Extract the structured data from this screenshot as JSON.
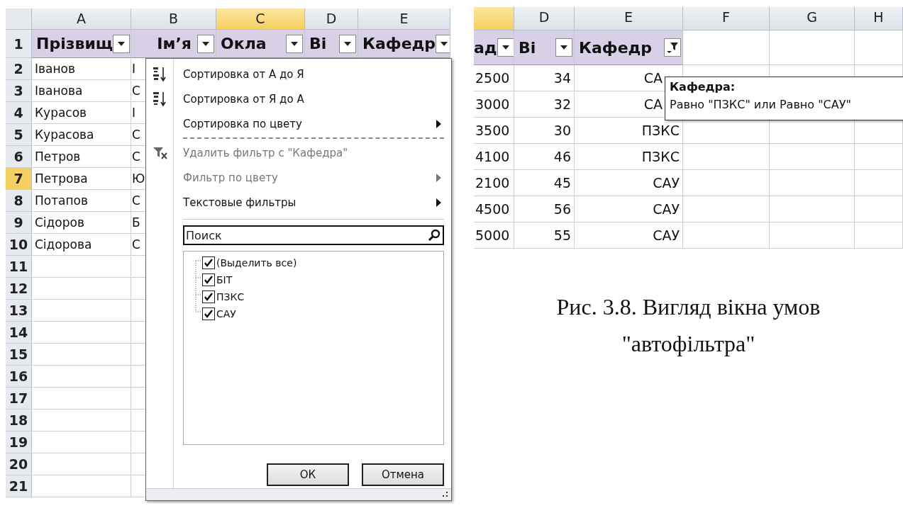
{
  "left_sheet": {
    "columns": [
      {
        "label": "A",
        "selected": false
      },
      {
        "label": "B",
        "selected": false
      },
      {
        "label": "C",
        "selected": true
      },
      {
        "label": "D",
        "selected": false
      },
      {
        "label": "E",
        "selected": false
      }
    ],
    "header_row": {
      "number": "1",
      "cells": [
        {
          "text": "Прізвищ",
          "filtered": false
        },
        {
          "text": "Ім’я",
          "filtered": false
        },
        {
          "text": "Окла",
          "filtered": false
        },
        {
          "text": "Ві",
          "filtered": false
        },
        {
          "text": "Кафедр",
          "filtered": false
        }
      ]
    },
    "rows": [
      {
        "number": "2",
        "selected": false,
        "cells": [
          "Іванов",
          "І"
        ]
      },
      {
        "number": "3",
        "selected": false,
        "cells": [
          "Іванова",
          "С"
        ]
      },
      {
        "number": "4",
        "selected": false,
        "cells": [
          "Курасов",
          "І"
        ]
      },
      {
        "number": "5",
        "selected": false,
        "cells": [
          "Курасова",
          "С"
        ]
      },
      {
        "number": "6",
        "selected": false,
        "cells": [
          "Петров",
          "С"
        ]
      },
      {
        "number": "7",
        "selected": true,
        "cells": [
          "Петрова",
          "Ю"
        ]
      },
      {
        "number": "8",
        "selected": false,
        "cells": [
          "Потапов",
          "С"
        ]
      },
      {
        "number": "9",
        "selected": false,
        "cells": [
          "Сідоров",
          "Б"
        ]
      },
      {
        "number": "10",
        "selected": false,
        "cells": [
          "Сідорова",
          "С"
        ]
      },
      {
        "number": "11",
        "selected": false,
        "cells": []
      },
      {
        "number": "12",
        "selected": false,
        "cells": []
      },
      {
        "number": "13",
        "selected": false,
        "cells": []
      },
      {
        "number": "14",
        "selected": false,
        "cells": []
      },
      {
        "number": "15",
        "selected": false,
        "cells": []
      },
      {
        "number": "16",
        "selected": false,
        "cells": []
      },
      {
        "number": "17",
        "selected": false,
        "cells": []
      },
      {
        "number": "18",
        "selected": false,
        "cells": []
      },
      {
        "number": "19",
        "selected": false,
        "cells": []
      },
      {
        "number": "20",
        "selected": false,
        "cells": []
      },
      {
        "number": "21",
        "selected": false,
        "cells": []
      }
    ],
    "filter_menu": {
      "items": [
        {
          "kind": "ascending",
          "label": "Сортировка от А до Я",
          "disabled": false,
          "submenu": false
        },
        {
          "kind": "descending",
          "label": "Сортировка от Я до А",
          "disabled": false,
          "submenu": false
        },
        {
          "kind": "plain",
          "label": "Сортировка по цвету",
          "disabled": false,
          "submenu": true
        },
        {
          "kind": "dashed"
        },
        {
          "kind": "unfilter",
          "label": "Удалить фильтр с \"Кафедра\"",
          "disabled": true,
          "submenu": false
        },
        {
          "kind": "plain",
          "label": "Фильтр по цвету",
          "disabled": true,
          "submenu": true
        },
        {
          "kind": "plain",
          "label": "Текстовые фильтры",
          "disabled": false,
          "submenu": true
        },
        {
          "kind": "rule"
        }
      ],
      "search": {
        "placeholder": "Поиск"
      },
      "values": [
        {
          "label": "(Выделить все)",
          "checked": true
        },
        {
          "label": "БІТ",
          "checked": true
        },
        {
          "label": "ПЗКС",
          "checked": true
        },
        {
          "label": "САУ",
          "checked": true
        }
      ],
      "buttons": [
        "ОК",
        "Отмена"
      ]
    }
  },
  "right_sheet": {
    "columns": [
      {
        "selected": true
      },
      {
        "label": "D",
        "selected": false
      },
      {
        "label": "E",
        "selected": false
      },
      {
        "label": "F",
        "selected": false
      },
      {
        "label": "G",
        "selected": false
      },
      {
        "label": "H",
        "selected": false
      }
    ],
    "header_row": {
      "cells": [
        {
          "text": "ад",
          "filtered": false
        },
        {
          "text": "Ві",
          "filtered": false
        },
        {
          "text": "Кафедр",
          "filtered": true
        }
      ]
    },
    "rows": [
      {
        "cells": [
          "2500",
          "34",
          "СА"
        ],
        "covered": true
      },
      {
        "cells": [
          "3000",
          "32",
          "СА"
        ],
        "covered": true
      },
      {
        "cells": [
          "3500",
          "30",
          "ПЗКС"
        ],
        "covered": false
      },
      {
        "cells": [
          "4100",
          "46",
          "ПЗКС"
        ],
        "covered": false
      },
      {
        "cells": [
          "2100",
          "45",
          "САУ"
        ],
        "covered": false
      },
      {
        "cells": [
          "4500",
          "56",
          "САУ"
        ],
        "covered": false
      },
      {
        "cells": [
          "5000",
          "55",
          "САУ"
        ],
        "covered": false
      }
    ],
    "tooltip": {
      "title": "Кафедра:",
      "text": "Равно \"ПЗКС\" или Равно \"САУ\""
    }
  },
  "caption": "Рис. 3.8. Вигляд вікна умов \"автофільтра\""
}
